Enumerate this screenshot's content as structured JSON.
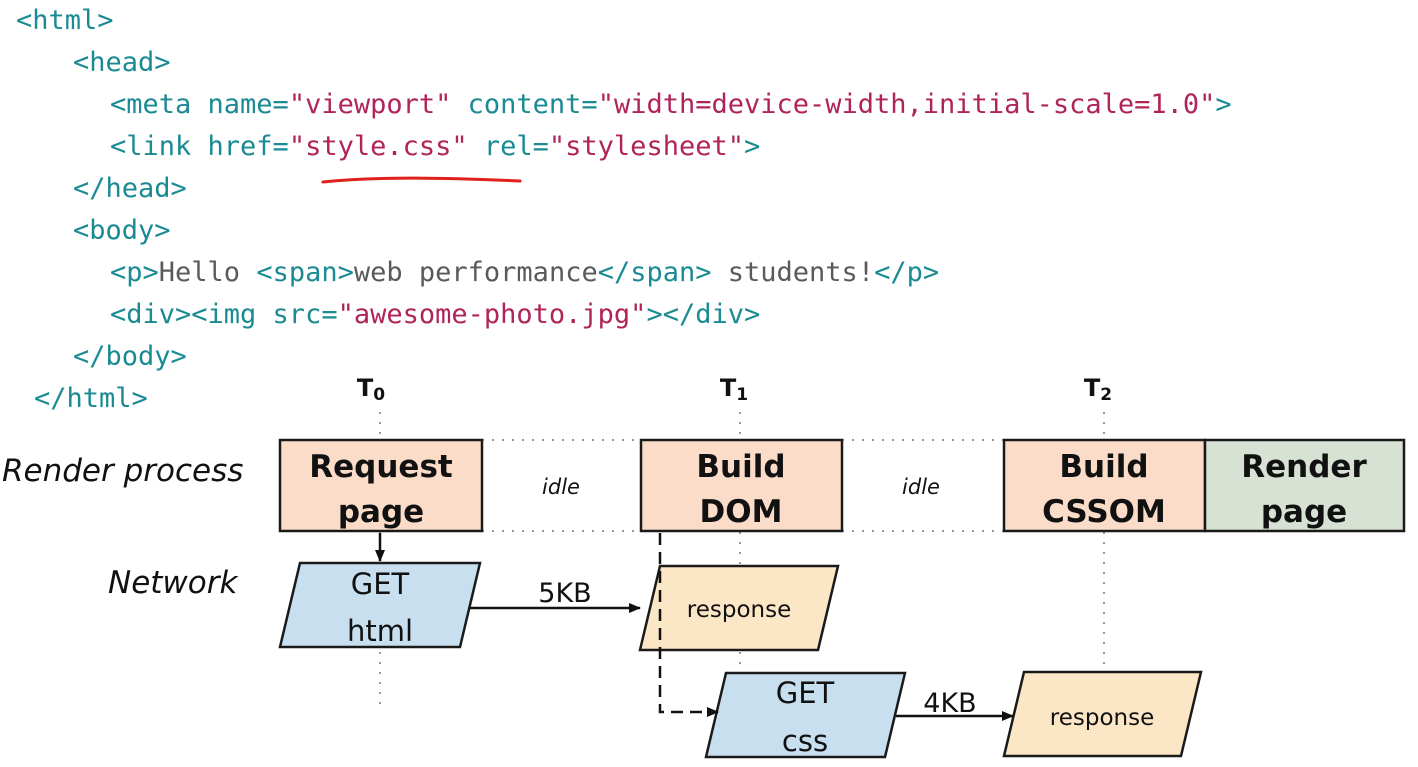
{
  "code": {
    "lines": [
      [
        {
          "c": "t",
          "text": "<html>"
        }
      ],
      [
        {
          "c": "t",
          "text": "<head>"
        }
      ],
      [
        {
          "c": "t",
          "text": "<meta name="
        },
        {
          "c": "s",
          "text": "\"viewport\""
        },
        {
          "c": "t",
          "text": " content="
        },
        {
          "c": "s",
          "text": "\"width=device-width,initial-scale=1.0\""
        },
        {
          "c": "t",
          "text": ">"
        }
      ],
      [
        {
          "c": "t",
          "text": "<link href="
        },
        {
          "c": "s",
          "text": "\"style.css\""
        },
        {
          "c": "t",
          "text": " rel="
        },
        {
          "c": "s",
          "text": "\"stylesheet\""
        },
        {
          "c": "t",
          "text": ">"
        }
      ],
      [
        {
          "c": "t",
          "text": "</head>"
        }
      ],
      [
        {
          "c": "t",
          "text": "<body>"
        }
      ],
      [
        {
          "c": "t",
          "text": "<p>"
        },
        {
          "c": "x",
          "text": "Hello "
        },
        {
          "c": "t",
          "text": "<span>"
        },
        {
          "c": "x",
          "text": "web performance"
        },
        {
          "c": "t",
          "text": "</span>"
        },
        {
          "c": "x",
          "text": " students!"
        },
        {
          "c": "t",
          "text": "</p>"
        }
      ],
      [
        {
          "c": "t",
          "text": "<div><img src="
        },
        {
          "c": "s",
          "text": "\"awesome-photo.jpg\""
        },
        {
          "c": "t",
          "text": "></div>"
        }
      ],
      [
        {
          "c": "t",
          "text": "</body>"
        }
      ],
      [
        {
          "c": "t",
          "text": "</html>"
        }
      ]
    ],
    "annotation_color": "#e0201a"
  },
  "diagram": {
    "rows": {
      "render": "Render process",
      "network": "Network"
    },
    "times": [
      {
        "main": "T",
        "sub": "0"
      },
      {
        "main": "T",
        "sub": "1"
      },
      {
        "main": "T",
        "sub": "2"
      }
    ],
    "render_boxes": [
      {
        "line1": "Request",
        "line2": "page"
      },
      {
        "line1": "Build",
        "line2": "DOM"
      },
      {
        "line1": "Build",
        "line2": "CSSOM"
      },
      {
        "line1": "Render",
        "line2": "page"
      }
    ],
    "idle": [
      "idle",
      "idle"
    ],
    "network_shapes": [
      {
        "line1": "GET",
        "line2": "html"
      },
      {
        "line1": "response"
      },
      {
        "line1": "GET",
        "line2": "css"
      },
      {
        "line1": "response"
      }
    ],
    "sizes": [
      "5KB",
      "4KB"
    ],
    "colors": {
      "process_fill": "#fbdcc9",
      "render_fill": "#d7e2d5",
      "request_fill": "#c8dff0",
      "response_fill": "#fbe6c6",
      "stroke": "#1a1a1a",
      "dots": "#999999"
    }
  }
}
